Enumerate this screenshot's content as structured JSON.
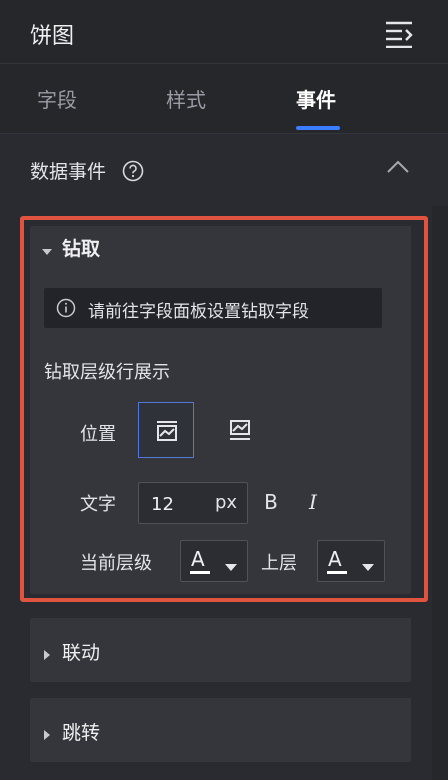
{
  "header": {
    "title": "饼图",
    "menu_icon": "collapse-menu-icon"
  },
  "tabs": [
    {
      "label": "字段",
      "active": false
    },
    {
      "label": "样式",
      "active": false
    },
    {
      "label": "事件",
      "active": true
    }
  ],
  "section": {
    "label": "数据事件",
    "help_icon": "question-circle-icon",
    "collapse_icon": "chevron-up-icon"
  },
  "drill": {
    "title": "钻取",
    "notice": "请前往字段面板设置钻取字段",
    "row_display_label": "钻取层级行展示",
    "position_label": "位置",
    "text_label": "文字",
    "font_size": "12",
    "font_unit": "px",
    "bold": "B",
    "italic": "I",
    "current_level_label": "当前层级",
    "upper_level_label": "上层",
    "color_glyph": "A",
    "text_color": "#ffffff"
  },
  "collapsed": [
    {
      "title": "联动"
    },
    {
      "title": "跳转"
    }
  ],
  "colors": {
    "accent": "#3a7dff",
    "highlight": "#e0533f",
    "background": "#1f2024",
    "card": "#35363c"
  }
}
